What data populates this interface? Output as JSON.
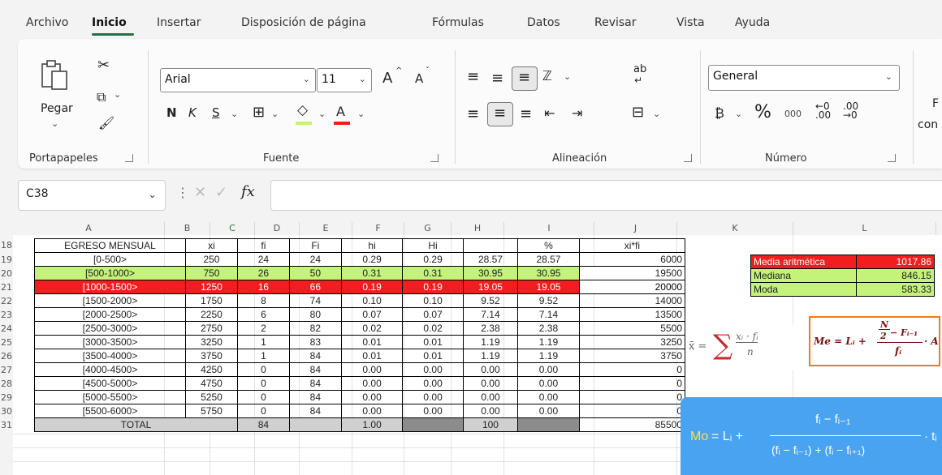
{
  "menu": {
    "items": [
      "Archivo",
      "Inicio",
      "Insertar",
      "Disposición de página",
      "Fórmulas",
      "Datos",
      "Revisar",
      "Vista",
      "Ayuda"
    ],
    "active": "Inicio"
  },
  "ribbon": {
    "clipboard": {
      "paste_label": "Pegar",
      "group": "Portapapeles"
    },
    "font": {
      "name": "Arial",
      "size": "11",
      "bold": "N",
      "italic": "K",
      "underline": "S",
      "grow": "A",
      "shrink": "A",
      "color_letter": "A",
      "group": "Fuente"
    },
    "alignment": {
      "group": "Alineación",
      "wrap": "ab"
    },
    "number": {
      "format": "General",
      "percent": "%",
      "thousands": "000",
      "group": "Número"
    },
    "overflow_partial": {
      "line1": "F",
      "line2": "con"
    }
  },
  "formula_bar": {
    "name_box": "C38",
    "fx": "fx",
    "value": ""
  },
  "columns": [
    "A",
    "B",
    "C",
    "D",
    "E",
    "F",
    "G",
    "H",
    "I",
    "J",
    "K",
    "L"
  ],
  "rows": [
    "18",
    "19",
    "20",
    "21",
    "22",
    "23",
    "24",
    "25",
    "26",
    "27",
    "28",
    "29",
    "30",
    "31"
  ],
  "table": {
    "headers": [
      "EGRESO MENSUAL",
      "xi",
      "fi",
      "Fi",
      "hi",
      "Hi",
      "",
      "%",
      "xi*fi"
    ],
    "rows": [
      [
        "[0-500>",
        "250",
        "24",
        "24",
        "0.29",
        "0.29",
        "28.57",
        "28.57",
        "6000"
      ],
      [
        "[500-1000>",
        "750",
        "26",
        "50",
        "0.31",
        "0.31",
        "30.95",
        "30.95",
        "19500"
      ],
      [
        "[1000-1500>",
        "1250",
        "16",
        "66",
        "0.19",
        "0.19",
        "19.05",
        "19.05",
        "20000"
      ],
      [
        "[1500-2000>",
        "1750",
        "8",
        "74",
        "0.10",
        "0.10",
        "9.52",
        "9.52",
        "14000"
      ],
      [
        "[2000-2500>",
        "2250",
        "6",
        "80",
        "0.07",
        "0.07",
        "7.14",
        "7.14",
        "13500"
      ],
      [
        "[2500-3000>",
        "2750",
        "2",
        "82",
        "0.02",
        "0.02",
        "2.38",
        "2.38",
        "5500"
      ],
      [
        "[3000-3500>",
        "3250",
        "1",
        "83",
        "0.01",
        "0.01",
        "1.19",
        "1.19",
        "3250"
      ],
      [
        "[3500-4000>",
        "3750",
        "1",
        "84",
        "0.01",
        "0.01",
        "1.19",
        "1.19",
        "3750"
      ],
      [
        "[4000-4500>",
        "4250",
        "0",
        "84",
        "0.00",
        "0.00",
        "0.00",
        "0.00",
        "0"
      ],
      [
        "[4500-5000>",
        "4750",
        "0",
        "84",
        "0.00",
        "0.00",
        "0.00",
        "0.00",
        "0"
      ],
      [
        "[5000-5500>",
        "5250",
        "0",
        "84",
        "0.00",
        "0.00",
        "0.00",
        "0.00",
        "0"
      ],
      [
        "[5500-6000>",
        "5750",
        "0",
        "84",
        "0.00",
        "0.00",
        "0.00",
        "0.00",
        "0"
      ]
    ],
    "total": [
      "TOTAL",
      "84",
      "1.00",
      "100",
      "85500"
    ]
  },
  "stats": [
    {
      "label": "Media aritmética",
      "value": "1017.86"
    },
    {
      "label": "Mediana",
      "value": "846.15"
    },
    {
      "label": "Moda",
      "value": "583.33"
    }
  ],
  "formulas": {
    "mean": {
      "lhs": "x̄ =",
      "sigma": "∑",
      "num": "xᵢ · fᵢ",
      "den": "n"
    },
    "median": {
      "lhs": "Me = Lᵢ +",
      "num_top": "N",
      "num_top_den": "2",
      "num_rest": "− Fᵢ₋₁",
      "den": "fᵢ",
      "tail": "· A"
    },
    "mode": {
      "lhs_mo": "Mo",
      "lhs_rest": " = Lᵢ +",
      "num": "fᵢ − fᵢ₋₁",
      "den": "(fᵢ − fᵢ₋₁) + (fᵢ − fᵢ₊₁)",
      "tail": "· tᵢ"
    }
  },
  "colors": {
    "green": "#c4f27a",
    "red": "#f01e1e",
    "mode_box": "#4aa3f0",
    "median_border": "#f07a1e",
    "accent": "#217346"
  }
}
